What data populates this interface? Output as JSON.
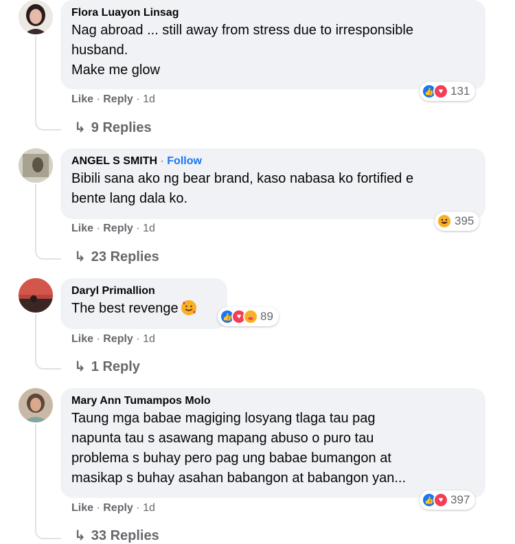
{
  "comments": [
    {
      "author": "Flora Luayon Linsag",
      "lines": [
        "Nag abroad ... still away from stress due to irresponsible",
        "husband.",
        "Make me glow"
      ],
      "like": "Like",
      "reply": "Reply",
      "time": "1d",
      "reaction_count": "131",
      "reactions": [
        "like-icon",
        "heart-icon"
      ],
      "replies": "9 Replies"
    },
    {
      "author": "ANGEL S SMITH",
      "follow": "Follow",
      "lines": [
        "Bibili sana ako ng bear brand, kaso nabasa ko fortified e",
        "bente lang dala ko."
      ],
      "like": "Like",
      "reply": "Reply",
      "time": "1d",
      "reaction_count": "395",
      "reactions": [
        "haha-icon"
      ],
      "replies": "23 Replies"
    },
    {
      "author": "Daryl Primallion",
      "lines": [
        "The best revenge"
      ],
      "like": "Like",
      "reply": "Reply",
      "time": "1d",
      "reaction_count": "89",
      "reactions": [
        "like-icon",
        "heart-icon",
        "care-icon"
      ],
      "replies": "1 Reply"
    },
    {
      "author": "Mary Ann Tumampos Molo",
      "lines": [
        "Taung mga babae magiging losyang tlaga tau pag",
        "napunta tau s asawang mapang abuso o puro tau",
        "problema s buhay pero pag ung babae bumangon at",
        "masikap s buhay asahan babangon at babangon yan..."
      ],
      "like": "Like",
      "reply": "Reply",
      "time": "1d",
      "reaction_count": "397",
      "reactions": [
        "like-icon",
        "heart-icon"
      ],
      "replies": "33 Replies"
    }
  ],
  "separator": "·"
}
